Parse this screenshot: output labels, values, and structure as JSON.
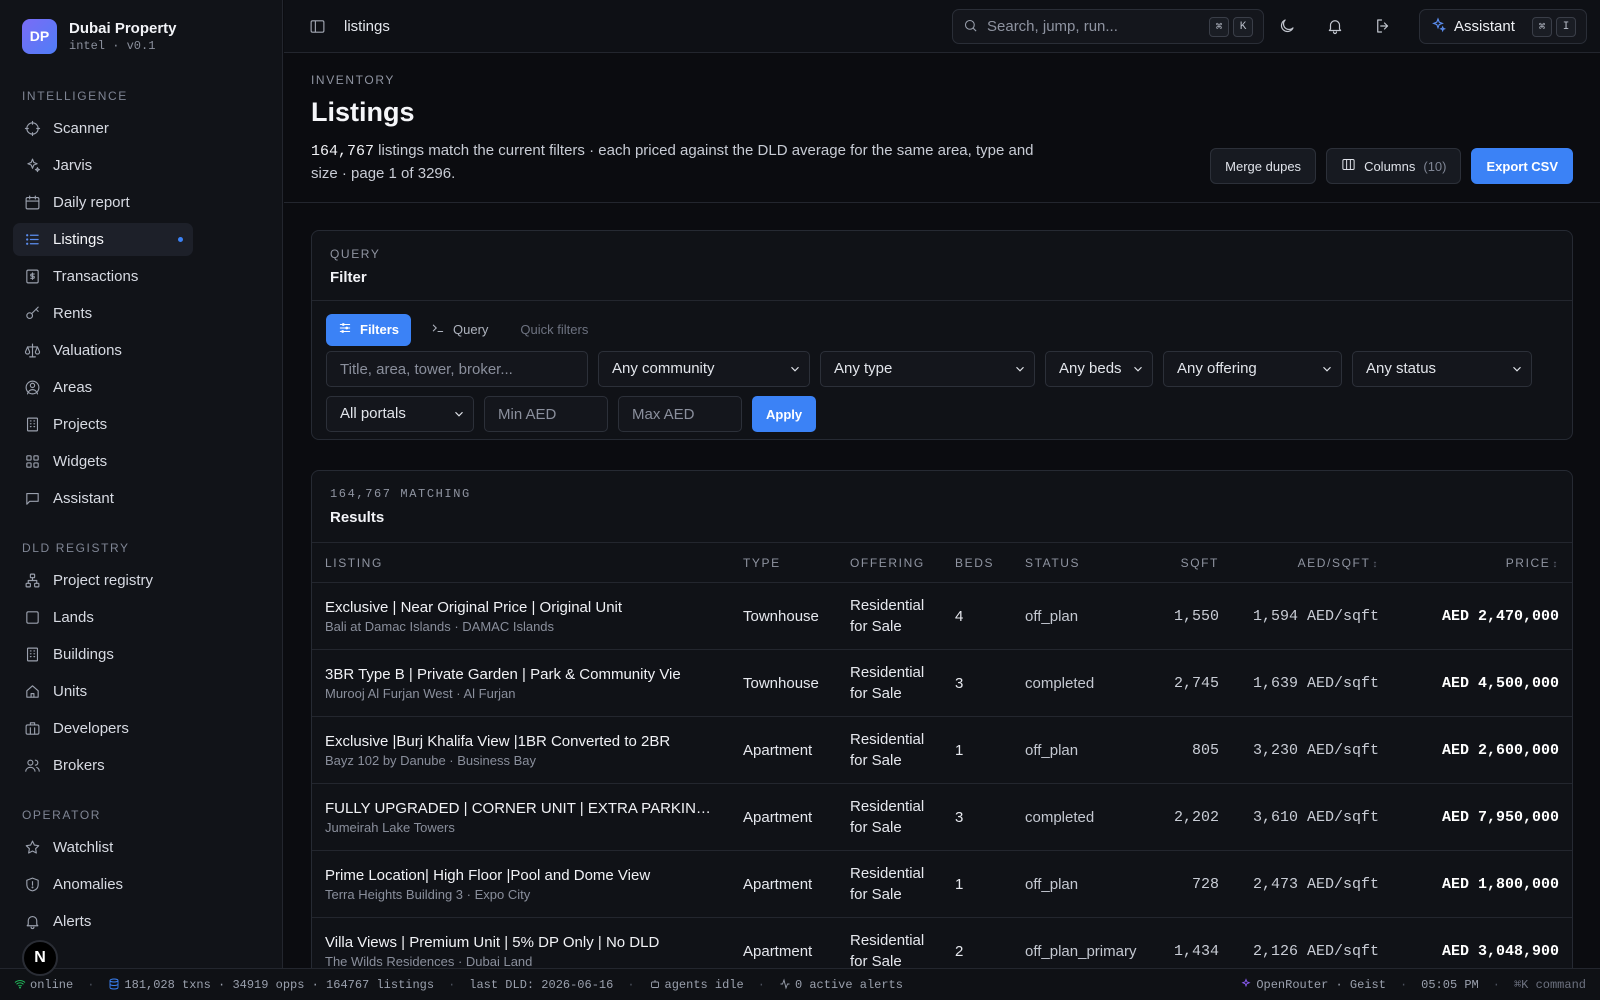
{
  "brand": {
    "badge": "DP",
    "title": "Dubai Property",
    "subtitle": "intel · v0.1"
  },
  "sidebar": {
    "sections": [
      {
        "label": "INTELLIGENCE",
        "items": [
          {
            "label": "Scanner",
            "icon": "crosshair-icon"
          },
          {
            "label": "Jarvis",
            "icon": "sparkles-icon"
          },
          {
            "label": "Daily report",
            "icon": "calendar-icon"
          },
          {
            "label": "Listings",
            "icon": "list-icon",
            "active": true
          },
          {
            "label": "Transactions",
            "icon": "receipt-icon"
          },
          {
            "label": "Rents",
            "icon": "key-icon"
          },
          {
            "label": "Valuations",
            "icon": "scale-icon"
          },
          {
            "label": "Areas",
            "icon": "map-pin-icon"
          },
          {
            "label": "Projects",
            "icon": "building-icon"
          },
          {
            "label": "Widgets",
            "icon": "grid-icon"
          },
          {
            "label": "Assistant",
            "icon": "chat-icon"
          }
        ]
      },
      {
        "label": "DLD REGISTRY",
        "items": [
          {
            "label": "Project registry",
            "icon": "network-icon"
          },
          {
            "label": "Lands",
            "icon": "square-icon"
          },
          {
            "label": "Buildings",
            "icon": "building-icon"
          },
          {
            "label": "Units",
            "icon": "home-icon"
          },
          {
            "label": "Developers",
            "icon": "briefcase-icon"
          },
          {
            "label": "Brokers",
            "icon": "users-icon"
          }
        ]
      },
      {
        "label": "OPERATOR",
        "items": [
          {
            "label": "Watchlist",
            "icon": "star-icon"
          },
          {
            "label": "Anomalies",
            "icon": "shield-icon"
          },
          {
            "label": "Alerts",
            "icon": "bell-icon"
          }
        ]
      }
    ]
  },
  "topbar": {
    "breadcrumb": "listings",
    "search_placeholder": "Search, jump, run...",
    "search_keys": [
      "⌘",
      "K"
    ],
    "assistant_label": "Assistant",
    "assistant_keys": [
      "⌘",
      "I"
    ]
  },
  "page": {
    "eyebrow": "INVENTORY",
    "title": "Listings",
    "count": "164,767",
    "description": " listings match the current filters · each priced against the DLD average for the same area, type and size · page 1 of 3296.",
    "actions": {
      "merge": "Merge dupes",
      "columns": "Columns",
      "columns_count": "(10)",
      "export": "Export CSV"
    }
  },
  "filter_card": {
    "eyebrow": "QUERY",
    "title": "Filter",
    "tabs": {
      "filters": "Filters",
      "query": "Query",
      "quick": "Quick filters"
    },
    "search_placeholder": "Title, area, tower, broker...",
    "community": "Any community",
    "type": "Any type",
    "beds": "Any beds",
    "offering": "Any offering",
    "status": "Any status",
    "portals": "All portals",
    "min_placeholder": "Min AED",
    "max_placeholder": "Max AED",
    "apply": "Apply"
  },
  "results": {
    "eyebrow": "164,767 MATCHING",
    "title": "Results",
    "columns": [
      "LISTING",
      "TYPE",
      "OFFERING",
      "BEDS",
      "STATUS",
      "SQFT",
      "AED/SQFT",
      "PRICE"
    ],
    "rows": [
      {
        "title": "Exclusive | Near Original Price | Original Unit",
        "sub": "Bali at Damac Islands · DAMAC Islands",
        "type": "Townhouse",
        "offering": [
          "Residential",
          "for Sale"
        ],
        "beds": "4",
        "status": "off_plan",
        "sqft": "1,550",
        "aed_sqft": "1,594 AED/sqft",
        "price": "AED 2,470,000"
      },
      {
        "title": "3BR Type B | Private Garden | Park & Community Vie",
        "sub": "Murooj Al Furjan West · Al Furjan",
        "type": "Townhouse",
        "offering": [
          "Residential",
          "for Sale"
        ],
        "beds": "3",
        "status": "completed",
        "sqft": "2,745",
        "aed_sqft": "1,639 AED/sqft",
        "price": "AED 4,500,000"
      },
      {
        "title": "Exclusive |Burj Khalifa View |1BR Converted to 2BR",
        "sub": "Bayz 102 by Danube · Business Bay",
        "type": "Apartment",
        "offering": [
          "Residential",
          "for Sale"
        ],
        "beds": "1",
        "status": "off_plan",
        "sqft": "805",
        "aed_sqft": "3,230 AED/sqft",
        "price": "AED 2,600,000"
      },
      {
        "title": "FULLY UPGRADED | CORNER UNIT | EXTRA PARKING ...",
        "sub": "Jumeirah Lake Towers",
        "type": "Apartment",
        "offering": [
          "Residential",
          "for Sale"
        ],
        "beds": "3",
        "status": "completed",
        "sqft": "2,202",
        "aed_sqft": "3,610 AED/sqft",
        "price": "AED 7,950,000"
      },
      {
        "title": "Prime Location| High Floor |Pool and Dome View",
        "sub": "Terra Heights Building 3 · Expo City",
        "type": "Apartment",
        "offering": [
          "Residential",
          "for Sale"
        ],
        "beds": "1",
        "status": "off_plan",
        "sqft": "728",
        "aed_sqft": "2,473 AED/sqft",
        "price": "AED 1,800,000"
      },
      {
        "title": "Villa Views | Premium Unit | 5% DP Only | No DLD",
        "sub": "The Wilds Residences · Dubai Land",
        "type": "Apartment",
        "offering": [
          "Residential",
          "for Sale"
        ],
        "beds": "2",
        "status": "off_plan_primary",
        "sqft": "1,434",
        "aed_sqft": "2,126 AED/sqft",
        "price": "AED 3,048,900"
      }
    ]
  },
  "statusbar": {
    "online": "online",
    "stats": "181,028 txns · 34919 opps · 164767 listings",
    "last_dld": "last DLD: 2026-06-16",
    "agents": "agents idle",
    "alerts": "0 active alerts",
    "router": "OpenRouter · Geist",
    "time": "05:05 PM",
    "command": "⌘K command"
  },
  "floating_badge": "N",
  "colors": {
    "accent": "#3b82f6",
    "brand_gradient": [
      "#7a6cf6",
      "#4f7df7"
    ],
    "online": "#22c55e"
  }
}
